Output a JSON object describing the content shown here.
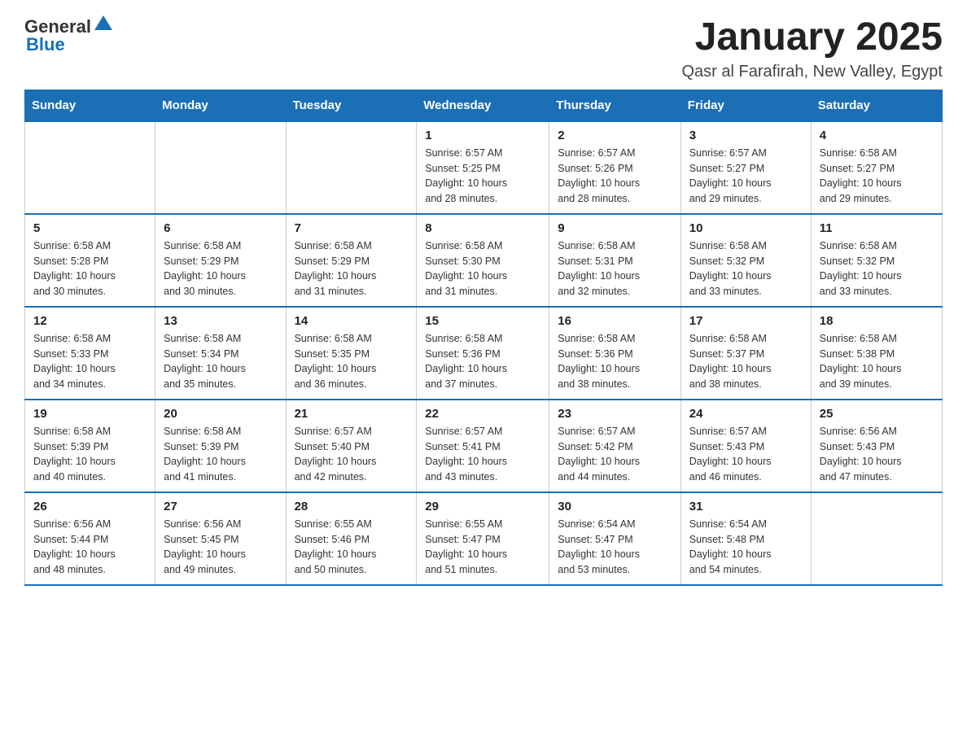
{
  "header": {
    "logo": {
      "general": "General",
      "blue": "Blue"
    },
    "title": "January 2025",
    "location": "Qasr al Farafirah, New Valley, Egypt"
  },
  "days_of_week": [
    "Sunday",
    "Monday",
    "Tuesday",
    "Wednesday",
    "Thursday",
    "Friday",
    "Saturday"
  ],
  "weeks": [
    [
      {
        "day": "",
        "info": ""
      },
      {
        "day": "",
        "info": ""
      },
      {
        "day": "",
        "info": ""
      },
      {
        "day": "1",
        "info": "Sunrise: 6:57 AM\nSunset: 5:25 PM\nDaylight: 10 hours\nand 28 minutes."
      },
      {
        "day": "2",
        "info": "Sunrise: 6:57 AM\nSunset: 5:26 PM\nDaylight: 10 hours\nand 28 minutes."
      },
      {
        "day": "3",
        "info": "Sunrise: 6:57 AM\nSunset: 5:27 PM\nDaylight: 10 hours\nand 29 minutes."
      },
      {
        "day": "4",
        "info": "Sunrise: 6:58 AM\nSunset: 5:27 PM\nDaylight: 10 hours\nand 29 minutes."
      }
    ],
    [
      {
        "day": "5",
        "info": "Sunrise: 6:58 AM\nSunset: 5:28 PM\nDaylight: 10 hours\nand 30 minutes."
      },
      {
        "day": "6",
        "info": "Sunrise: 6:58 AM\nSunset: 5:29 PM\nDaylight: 10 hours\nand 30 minutes."
      },
      {
        "day": "7",
        "info": "Sunrise: 6:58 AM\nSunset: 5:29 PM\nDaylight: 10 hours\nand 31 minutes."
      },
      {
        "day": "8",
        "info": "Sunrise: 6:58 AM\nSunset: 5:30 PM\nDaylight: 10 hours\nand 31 minutes."
      },
      {
        "day": "9",
        "info": "Sunrise: 6:58 AM\nSunset: 5:31 PM\nDaylight: 10 hours\nand 32 minutes."
      },
      {
        "day": "10",
        "info": "Sunrise: 6:58 AM\nSunset: 5:32 PM\nDaylight: 10 hours\nand 33 minutes."
      },
      {
        "day": "11",
        "info": "Sunrise: 6:58 AM\nSunset: 5:32 PM\nDaylight: 10 hours\nand 33 minutes."
      }
    ],
    [
      {
        "day": "12",
        "info": "Sunrise: 6:58 AM\nSunset: 5:33 PM\nDaylight: 10 hours\nand 34 minutes."
      },
      {
        "day": "13",
        "info": "Sunrise: 6:58 AM\nSunset: 5:34 PM\nDaylight: 10 hours\nand 35 minutes."
      },
      {
        "day": "14",
        "info": "Sunrise: 6:58 AM\nSunset: 5:35 PM\nDaylight: 10 hours\nand 36 minutes."
      },
      {
        "day": "15",
        "info": "Sunrise: 6:58 AM\nSunset: 5:36 PM\nDaylight: 10 hours\nand 37 minutes."
      },
      {
        "day": "16",
        "info": "Sunrise: 6:58 AM\nSunset: 5:36 PM\nDaylight: 10 hours\nand 38 minutes."
      },
      {
        "day": "17",
        "info": "Sunrise: 6:58 AM\nSunset: 5:37 PM\nDaylight: 10 hours\nand 38 minutes."
      },
      {
        "day": "18",
        "info": "Sunrise: 6:58 AM\nSunset: 5:38 PM\nDaylight: 10 hours\nand 39 minutes."
      }
    ],
    [
      {
        "day": "19",
        "info": "Sunrise: 6:58 AM\nSunset: 5:39 PM\nDaylight: 10 hours\nand 40 minutes."
      },
      {
        "day": "20",
        "info": "Sunrise: 6:58 AM\nSunset: 5:39 PM\nDaylight: 10 hours\nand 41 minutes."
      },
      {
        "day": "21",
        "info": "Sunrise: 6:57 AM\nSunset: 5:40 PM\nDaylight: 10 hours\nand 42 minutes."
      },
      {
        "day": "22",
        "info": "Sunrise: 6:57 AM\nSunset: 5:41 PM\nDaylight: 10 hours\nand 43 minutes."
      },
      {
        "day": "23",
        "info": "Sunrise: 6:57 AM\nSunset: 5:42 PM\nDaylight: 10 hours\nand 44 minutes."
      },
      {
        "day": "24",
        "info": "Sunrise: 6:57 AM\nSunset: 5:43 PM\nDaylight: 10 hours\nand 46 minutes."
      },
      {
        "day": "25",
        "info": "Sunrise: 6:56 AM\nSunset: 5:43 PM\nDaylight: 10 hours\nand 47 minutes."
      }
    ],
    [
      {
        "day": "26",
        "info": "Sunrise: 6:56 AM\nSunset: 5:44 PM\nDaylight: 10 hours\nand 48 minutes."
      },
      {
        "day": "27",
        "info": "Sunrise: 6:56 AM\nSunset: 5:45 PM\nDaylight: 10 hours\nand 49 minutes."
      },
      {
        "day": "28",
        "info": "Sunrise: 6:55 AM\nSunset: 5:46 PM\nDaylight: 10 hours\nand 50 minutes."
      },
      {
        "day": "29",
        "info": "Sunrise: 6:55 AM\nSunset: 5:47 PM\nDaylight: 10 hours\nand 51 minutes."
      },
      {
        "day": "30",
        "info": "Sunrise: 6:54 AM\nSunset: 5:47 PM\nDaylight: 10 hours\nand 53 minutes."
      },
      {
        "day": "31",
        "info": "Sunrise: 6:54 AM\nSunset: 5:48 PM\nDaylight: 10 hours\nand 54 minutes."
      },
      {
        "day": "",
        "info": ""
      }
    ]
  ]
}
